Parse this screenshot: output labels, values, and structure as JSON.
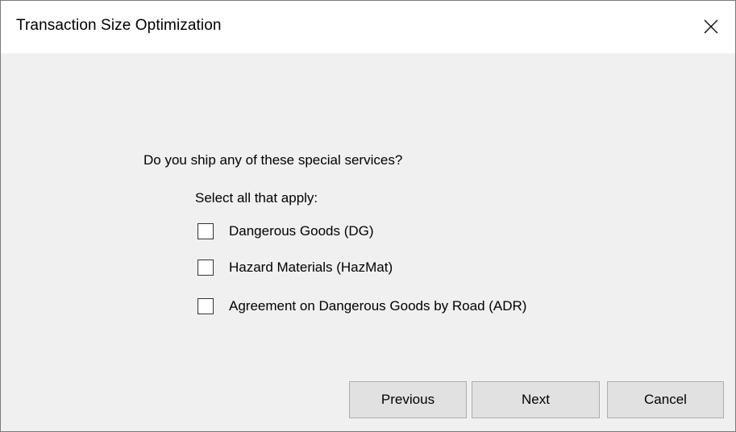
{
  "window": {
    "title": "Transaction Size Optimization"
  },
  "titlebar": {
    "close_icon": "close-icon"
  },
  "form": {
    "question": "Do you ship any of these special services?",
    "subprompt": "Select all that apply:",
    "options": [
      {
        "label": "Dangerous Goods (DG)",
        "checked": false
      },
      {
        "label": "Hazard Materials (HazMat)",
        "checked": false
      },
      {
        "label": "Agreement on Dangerous Goods by Road (ADR)",
        "checked": false
      }
    ]
  },
  "buttons": {
    "previous": "Previous",
    "next": "Next",
    "cancel": "Cancel"
  }
}
